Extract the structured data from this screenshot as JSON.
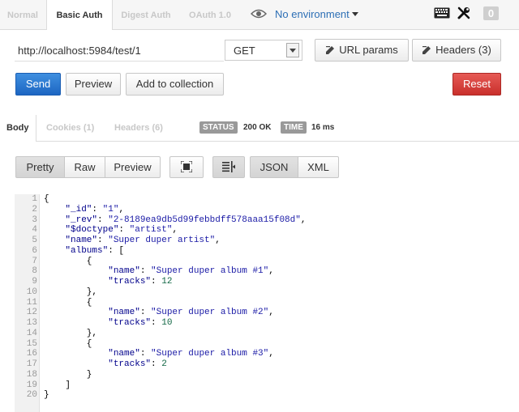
{
  "auth_tabs": [
    "Normal",
    "Basic Auth",
    "Digest Auth",
    "OAuth 1.0"
  ],
  "environment": "No environment",
  "notification_count": "0",
  "request": {
    "url": "http://localhost:5984/test/1",
    "method": "GET",
    "url_params_label": "URL params",
    "headers_label": "Headers (3)",
    "send_label": "Send",
    "preview_label": "Preview",
    "add_collection_label": "Add to collection",
    "reset_label": "Reset"
  },
  "response": {
    "tabs": [
      "Body",
      "Cookies (1)",
      "Headers (6)"
    ],
    "status_label": "STATUS",
    "status_value": "200 OK",
    "time_label": "TIME",
    "time_value": "16 ms",
    "view_buttons": [
      "Pretty",
      "Raw",
      "Preview"
    ],
    "format_buttons": [
      "JSON",
      "XML"
    ]
  },
  "body_lines": [
    "{",
    "    \"_id\": \"1\",",
    "    \"_rev\": \"2-8189ea9db5d99febbdff578aaa15f08d\",",
    "    \"$doctype\": \"artist\",",
    "    \"name\": \"Super duper artist\",",
    "    \"albums\": [",
    "        {",
    "            \"name\": \"Super duper album #1\",",
    "            \"tracks\": 12",
    "        },",
    "        {",
    "            \"name\": \"Super duper album #2\",",
    "            \"tracks\": 10",
    "        },",
    "        {",
    "            \"name\": \"Super duper album #3\",",
    "            \"tracks\": 2",
    "        }",
    "    ]",
    "}"
  ],
  "line_numbers": [
    "1",
    "2",
    "3",
    "4",
    "5",
    "6",
    "7",
    "8",
    "9",
    "10",
    "11",
    "12",
    "13",
    "14",
    "15",
    "16",
    "17",
    "18",
    "19",
    "20"
  ],
  "colors": {
    "primary": "#1d66c2",
    "danger": "#c9302c",
    "link": "#2d6fb5"
  }
}
